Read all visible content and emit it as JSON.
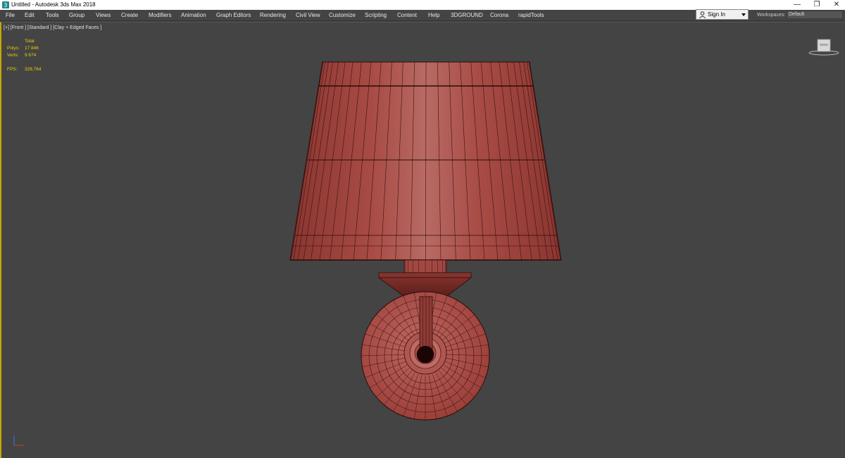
{
  "window": {
    "title": "Untitled - Autodesk 3ds Max 2018",
    "minimize": "—",
    "maximize": "❐",
    "close": "✕"
  },
  "menu": [
    {
      "label": "File"
    },
    {
      "label": "Edit"
    },
    {
      "label": "Tools"
    },
    {
      "label": "Group"
    },
    {
      "label": "Views"
    },
    {
      "label": "Create"
    },
    {
      "label": "Modifiers"
    },
    {
      "label": "Animation"
    },
    {
      "label": "Graph Editors"
    },
    {
      "label": "Rendering"
    },
    {
      "label": "Civil View"
    },
    {
      "label": "Customize"
    },
    {
      "label": "Scripting"
    },
    {
      "label": "Content"
    },
    {
      "label": "Help"
    },
    {
      "label": "3DGROUND"
    },
    {
      "label": "Corona"
    },
    {
      "label": "rapidTools"
    }
  ],
  "account": {
    "signin_label": "Sign In",
    "workspaces_label": "Workspaces:",
    "workspace_value": "Default"
  },
  "viewport": {
    "label": "[+] [Front ] [Standard ] [Clay + Edged Faces ]",
    "stats": {
      "total_header": "Total",
      "polys_label": "Polys:",
      "polys_value": "17 846",
      "verts_label": "Verts:",
      "verts_value": "9 674",
      "fps_label": "FPS:",
      "fps_value": "328,764"
    }
  },
  "colors": {
    "model_fill": "#a0453f",
    "model_wire": "#2a0c0a",
    "viewport_bg": "#444444",
    "stats_text": "#e8d000",
    "active_border": "#c8a800"
  }
}
